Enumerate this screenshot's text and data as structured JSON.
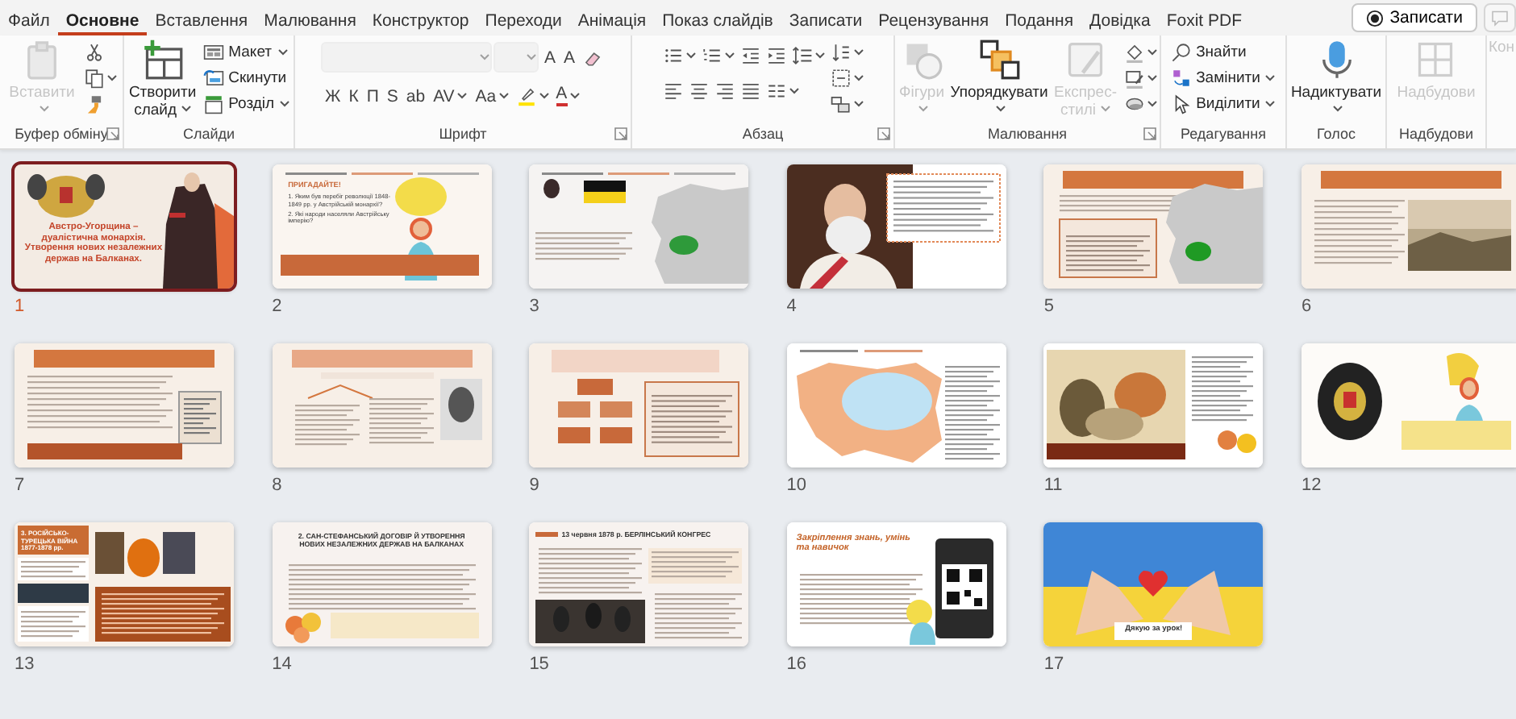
{
  "tabs": [
    {
      "label": "Файл",
      "selected": false
    },
    {
      "label": "Основне",
      "selected": true
    },
    {
      "label": "Вставлення",
      "selected": false
    },
    {
      "label": "Малювання",
      "selected": false
    },
    {
      "label": "Конструктор",
      "selected": false
    },
    {
      "label": "Переходи",
      "selected": false
    },
    {
      "label": "Анімація",
      "selected": false
    },
    {
      "label": "Показ слайдів",
      "selected": false
    },
    {
      "label": "Записати",
      "selected": false
    },
    {
      "label": "Рецензування",
      "selected": false
    },
    {
      "label": "Подання",
      "selected": false
    },
    {
      "label": "Довідка",
      "selected": false
    },
    {
      "label": "Foxit PDF",
      "selected": false
    }
  ],
  "record_button": {
    "label": "Записати"
  },
  "ribbon": [
    {
      "label": "Буфер обміну",
      "launcher": true,
      "blocks": [
        {
          "kind": "large",
          "label": "Вставити",
          "disabled": true,
          "dropdown": true
        },
        {
          "kind": "stack",
          "items": [
            {
              "kind": "icon",
              "disabled": false,
              "dropdown": false
            },
            {
              "kind": "icon",
              "disabled": false,
              "dropdown": true
            },
            {
              "kind": "icon",
              "disabled": false,
              "dropdown": false
            }
          ]
        }
      ]
    },
    {
      "label": "Слайди",
      "launcher": false,
      "blocks": [
        {
          "kind": "large",
          "label": "Створити слайд",
          "disabled": false,
          "dropdown": true
        },
        {
          "kind": "stack",
          "items": [
            {
              "kind": "small",
              "label": "Макет",
              "disabled": false,
              "dropdown": true
            },
            {
              "kind": "small",
              "label": "Скинути",
              "disabled": false,
              "dropdown": false
            },
            {
              "kind": "small",
              "label": "Розділ",
              "disabled": false,
              "dropdown": true
            }
          ]
        }
      ]
    },
    {
      "label": "Шрифт",
      "launcher": true,
      "blocks": [
        {
          "kind": "rows",
          "rows": [
            [
              {
                "kind": "field",
                "disabled": true
              },
              {
                "kind": "field",
                "disabled": true
              },
              {
                "kind": "letter",
                "label": "A",
                "disabled": false,
                "dropdown": false
              },
              {
                "kind": "letter",
                "label": "A",
                "disabled": false,
                "dropdown": false
              },
              {
                "kind": "icon",
                "disabled": false,
                "dropdown": false
              }
            ],
            [
              {
                "kind": "letter",
                "label": "Ж",
                "disabled": false,
                "dropdown": false
              },
              {
                "kind": "letter",
                "label": "К",
                "disabled": false,
                "dropdown": false
              },
              {
                "kind": "letter",
                "label": "П",
                "disabled": false,
                "dropdown": false
              },
              {
                "kind": "letter",
                "label": "S",
                "disabled": false,
                "dropdown": false
              },
              {
                "kind": "letter",
                "label": "ab",
                "disabled": false,
                "dropdown": false
              },
              {
                "kind": "letter",
                "label": "AV",
                "disabled": false,
                "dropdown": true
              },
              {
                "kind": "letter",
                "label": "Aa",
                "disabled": false,
                "dropdown": true
              },
              {
                "kind": "icon",
                "disabled": false,
                "dropdown": true
              },
              {
                "kind": "letter",
                "label": "A",
                "disabled": false,
                "dropdown": true
              }
            ]
          ]
        }
      ]
    },
    {
      "label": "Абзац",
      "launcher": true,
      "blocks": [
        {
          "kind": "rows",
          "rows": [
            [
              {
                "kind": "icon",
                "disabled": false,
                "dropdown": true
              },
              {
                "kind": "icon",
                "disabled": false,
                "dropdown": true
              },
              {
                "kind": "icon",
                "disabled": false,
                "dropdown": false
              },
              {
                "kind": "icon",
                "disabled": false,
                "dropdown": false
              },
              {
                "kind": "icon",
                "disabled": false,
                "dropdown": true
              }
            ],
            [
              {
                "kind": "icon",
                "disabled": false,
                "dropdown": false
              },
              {
                "kind": "icon",
                "disabled": false,
                "dropdown": false
              },
              {
                "kind": "icon",
                "disabled": false,
                "dropdown": false
              },
              {
                "kind": "icon",
                "disabled": false,
                "dropdown": false
              },
              {
                "kind": "icon",
                "disabled": false,
                "dropdown": true
              }
            ]
          ]
        },
        {
          "kind": "stack",
          "items": [
            {
              "kind": "icon",
              "disabled": false,
              "dropdown": true
            },
            {
              "kind": "icon",
              "disabled": false,
              "dropdown": true
            },
            {
              "kind": "icon",
              "disabled": false,
              "dropdown": true
            }
          ]
        }
      ]
    },
    {
      "label": "Малювання",
      "launcher": true,
      "blocks": [
        {
          "kind": "large",
          "label": "Фігури",
          "disabled": true,
          "dropdown": true
        },
        {
          "kind": "large",
          "label": "Упорядкувати",
          "disabled": false,
          "dropdown": true
        },
        {
          "kind": "large",
          "label": "Експрес-стилі",
          "disabled": true,
          "dropdown": true
        },
        {
          "kind": "stack",
          "items": [
            {
              "kind": "icon",
              "disabled": false,
              "dropdown": true
            },
            {
              "kind": "icon",
              "disabled": false,
              "dropdown": true
            },
            {
              "kind": "icon",
              "disabled": false,
              "dropdown": true
            }
          ]
        }
      ]
    },
    {
      "label": "Редагування",
      "launcher": false,
      "blocks": [
        {
          "kind": "stack",
          "items": [
            {
              "kind": "small",
              "label": "Знайти",
              "disabled": false,
              "dropdown": false
            },
            {
              "kind": "small",
              "label": "Замінити",
              "disabled": false,
              "dropdown": true
            },
            {
              "kind": "small",
              "label": "Виділити",
              "disabled": false,
              "dropdown": true
            }
          ]
        }
      ]
    },
    {
      "label": "Голос",
      "launcher": false,
      "blocks": [
        {
          "kind": "large",
          "label": "Надиктувати",
          "disabled": false,
          "dropdown": true
        }
      ]
    },
    {
      "label": "Надбудови",
      "launcher": false,
      "blocks": [
        {
          "kind": "large",
          "label": "Надбудови",
          "disabled": true,
          "dropdown": false
        }
      ]
    },
    {
      "blocks": [
        {
          "kind": "large",
          "label": "Кон",
          "disabled": true,
          "dropdown": false
        }
      ]
    }
  ],
  "slides": [
    {
      "number": "1",
      "selected": true,
      "kind": "cover",
      "texts": [
        {
          "kind": "title",
          "text": "Австро-Угорщина – дуалістична монархія. Утворення нових незалежних держав на Балканах."
        }
      ]
    },
    {
      "number": "2",
      "selected": false,
      "kind": "question",
      "texts": [
        {
          "kind": "heading",
          "text": "ПРИГАДАЙТЕ!"
        },
        {
          "kind": "item",
          "text": "1. Яким був перебіг революції 1848-1849 рр. у Австрійській монархії?"
        },
        {
          "kind": "item",
          "text": "2. Які народи населяли Австрійську імперію?"
        }
      ]
    },
    {
      "number": "3",
      "selected": false,
      "kind": "map"
    },
    {
      "number": "4",
      "selected": false,
      "kind": "portrait"
    },
    {
      "number": "5",
      "selected": false,
      "kind": "banner-map"
    },
    {
      "number": "6",
      "selected": false,
      "kind": "banner-photo"
    },
    {
      "number": "7",
      "selected": false,
      "kind": "banner-text"
    },
    {
      "number": "8",
      "selected": false,
      "kind": "banner-portrait"
    },
    {
      "number": "9",
      "selected": false,
      "kind": "diagram"
    },
    {
      "number": "10",
      "selected": false,
      "kind": "map-color"
    },
    {
      "number": "11",
      "selected": false,
      "kind": "cartoon"
    },
    {
      "number": "12",
      "selected": false,
      "kind": "emblem"
    },
    {
      "number": "13",
      "selected": false,
      "kind": "war",
      "texts": [
        {
          "kind": "title",
          "text": "3. РОСІЙСЬКО-ТУРЕЦЬКА ВІЙНА 1877-1878 рр."
        }
      ]
    },
    {
      "number": "14",
      "selected": false,
      "kind": "title-text",
      "texts": [
        {
          "kind": "title",
          "text": "2. САН-СТЕФАНСЬКИЙ ДОГОВІР Й УТВОРЕННЯ НОВИХ НЕЗАЛЕЖНИХ ДЕРЖАВ НА БАЛКАНАХ"
        }
      ]
    },
    {
      "number": "15",
      "selected": false,
      "kind": "congress",
      "texts": [
        {
          "kind": "title",
          "text": "13 червня 1878 р. БЕРЛІНСЬКИЙ КОНГРЕС"
        }
      ]
    },
    {
      "number": "16",
      "selected": false,
      "kind": "qr",
      "texts": [
        {
          "kind": "title",
          "text": "Закріплення знань, умінь та навичок"
        }
      ]
    },
    {
      "number": "17",
      "selected": false,
      "kind": "thanks",
      "texts": [
        {
          "kind": "title",
          "text": "Дякую за урок!"
        }
      ]
    }
  ]
}
